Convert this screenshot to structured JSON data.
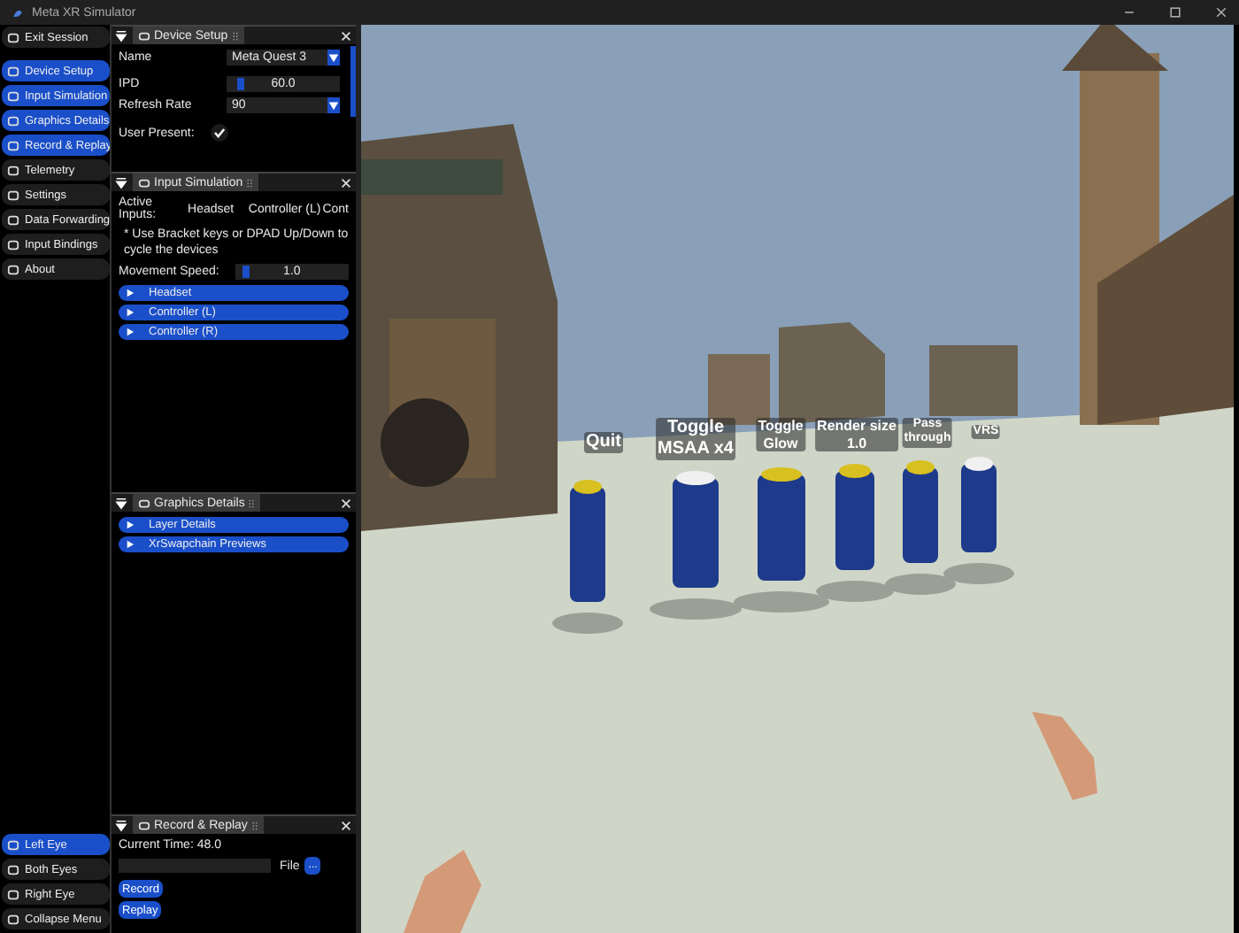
{
  "window": {
    "title": "Meta XR Simulator"
  },
  "sidebar": {
    "top_items": [
      {
        "label": "Exit Session",
        "selected": false
      },
      {
        "label": "Device Setup",
        "selected": true
      },
      {
        "label": "Input Simulation",
        "selected": true
      },
      {
        "label": "Graphics Details",
        "selected": true
      },
      {
        "label": "Record & Replay",
        "selected": true
      },
      {
        "label": "Telemetry",
        "selected": false
      },
      {
        "label": "Settings",
        "selected": false
      },
      {
        "label": "Data Forwarding",
        "selected": false
      },
      {
        "label": "Input Bindings",
        "selected": false
      },
      {
        "label": "About",
        "selected": false
      }
    ],
    "bottom_items": [
      {
        "label": "Left Eye",
        "selected": true
      },
      {
        "label": "Both Eyes",
        "selected": false
      },
      {
        "label": "Right Eye",
        "selected": false
      },
      {
        "label": "Collapse Menu",
        "selected": false
      }
    ]
  },
  "device_setup": {
    "title": "Device Setup",
    "name_label": "Name",
    "name_value": "Meta Quest 3",
    "ipd_label": "IPD",
    "ipd": {
      "value": "60.0",
      "level": 0.1
    },
    "refresh_label": "Refresh Rate",
    "refresh_value": "90",
    "user_present_label": "User Present:",
    "user_present": true
  },
  "input_simulation": {
    "title": "Input Simulation",
    "active_inputs": [
      "Active Inputs:",
      "Headset",
      "Controller (L)",
      "Cont"
    ],
    "note": "* Use Bracket keys or DPAD Up/Down to cycle the devices",
    "speed_label": "Movement Speed:",
    "speed": {
      "value": "1.0",
      "level": 0.06
    },
    "sections": [
      "Headset",
      "Controller (L)",
      "Controller (R)"
    ]
  },
  "graphics_details": {
    "title": "Graphics Details",
    "sections": [
      "Layer Details",
      "XrSwapchain Previews"
    ]
  },
  "record_replay": {
    "title": "Record & Replay",
    "current_time": "Current Time: 48.0",
    "file_label": "File",
    "browse": "...",
    "buttons": [
      "Record",
      "Replay"
    ]
  },
  "scene": {
    "labels": [
      [
        "Quit"
      ],
      [
        "Toggle",
        "MSAA x4"
      ],
      [
        "Toggle",
        "Glow"
      ],
      [
        "Render size",
        "1.0"
      ],
      [
        "Pass",
        "through"
      ],
      [
        "VRS"
      ]
    ]
  }
}
